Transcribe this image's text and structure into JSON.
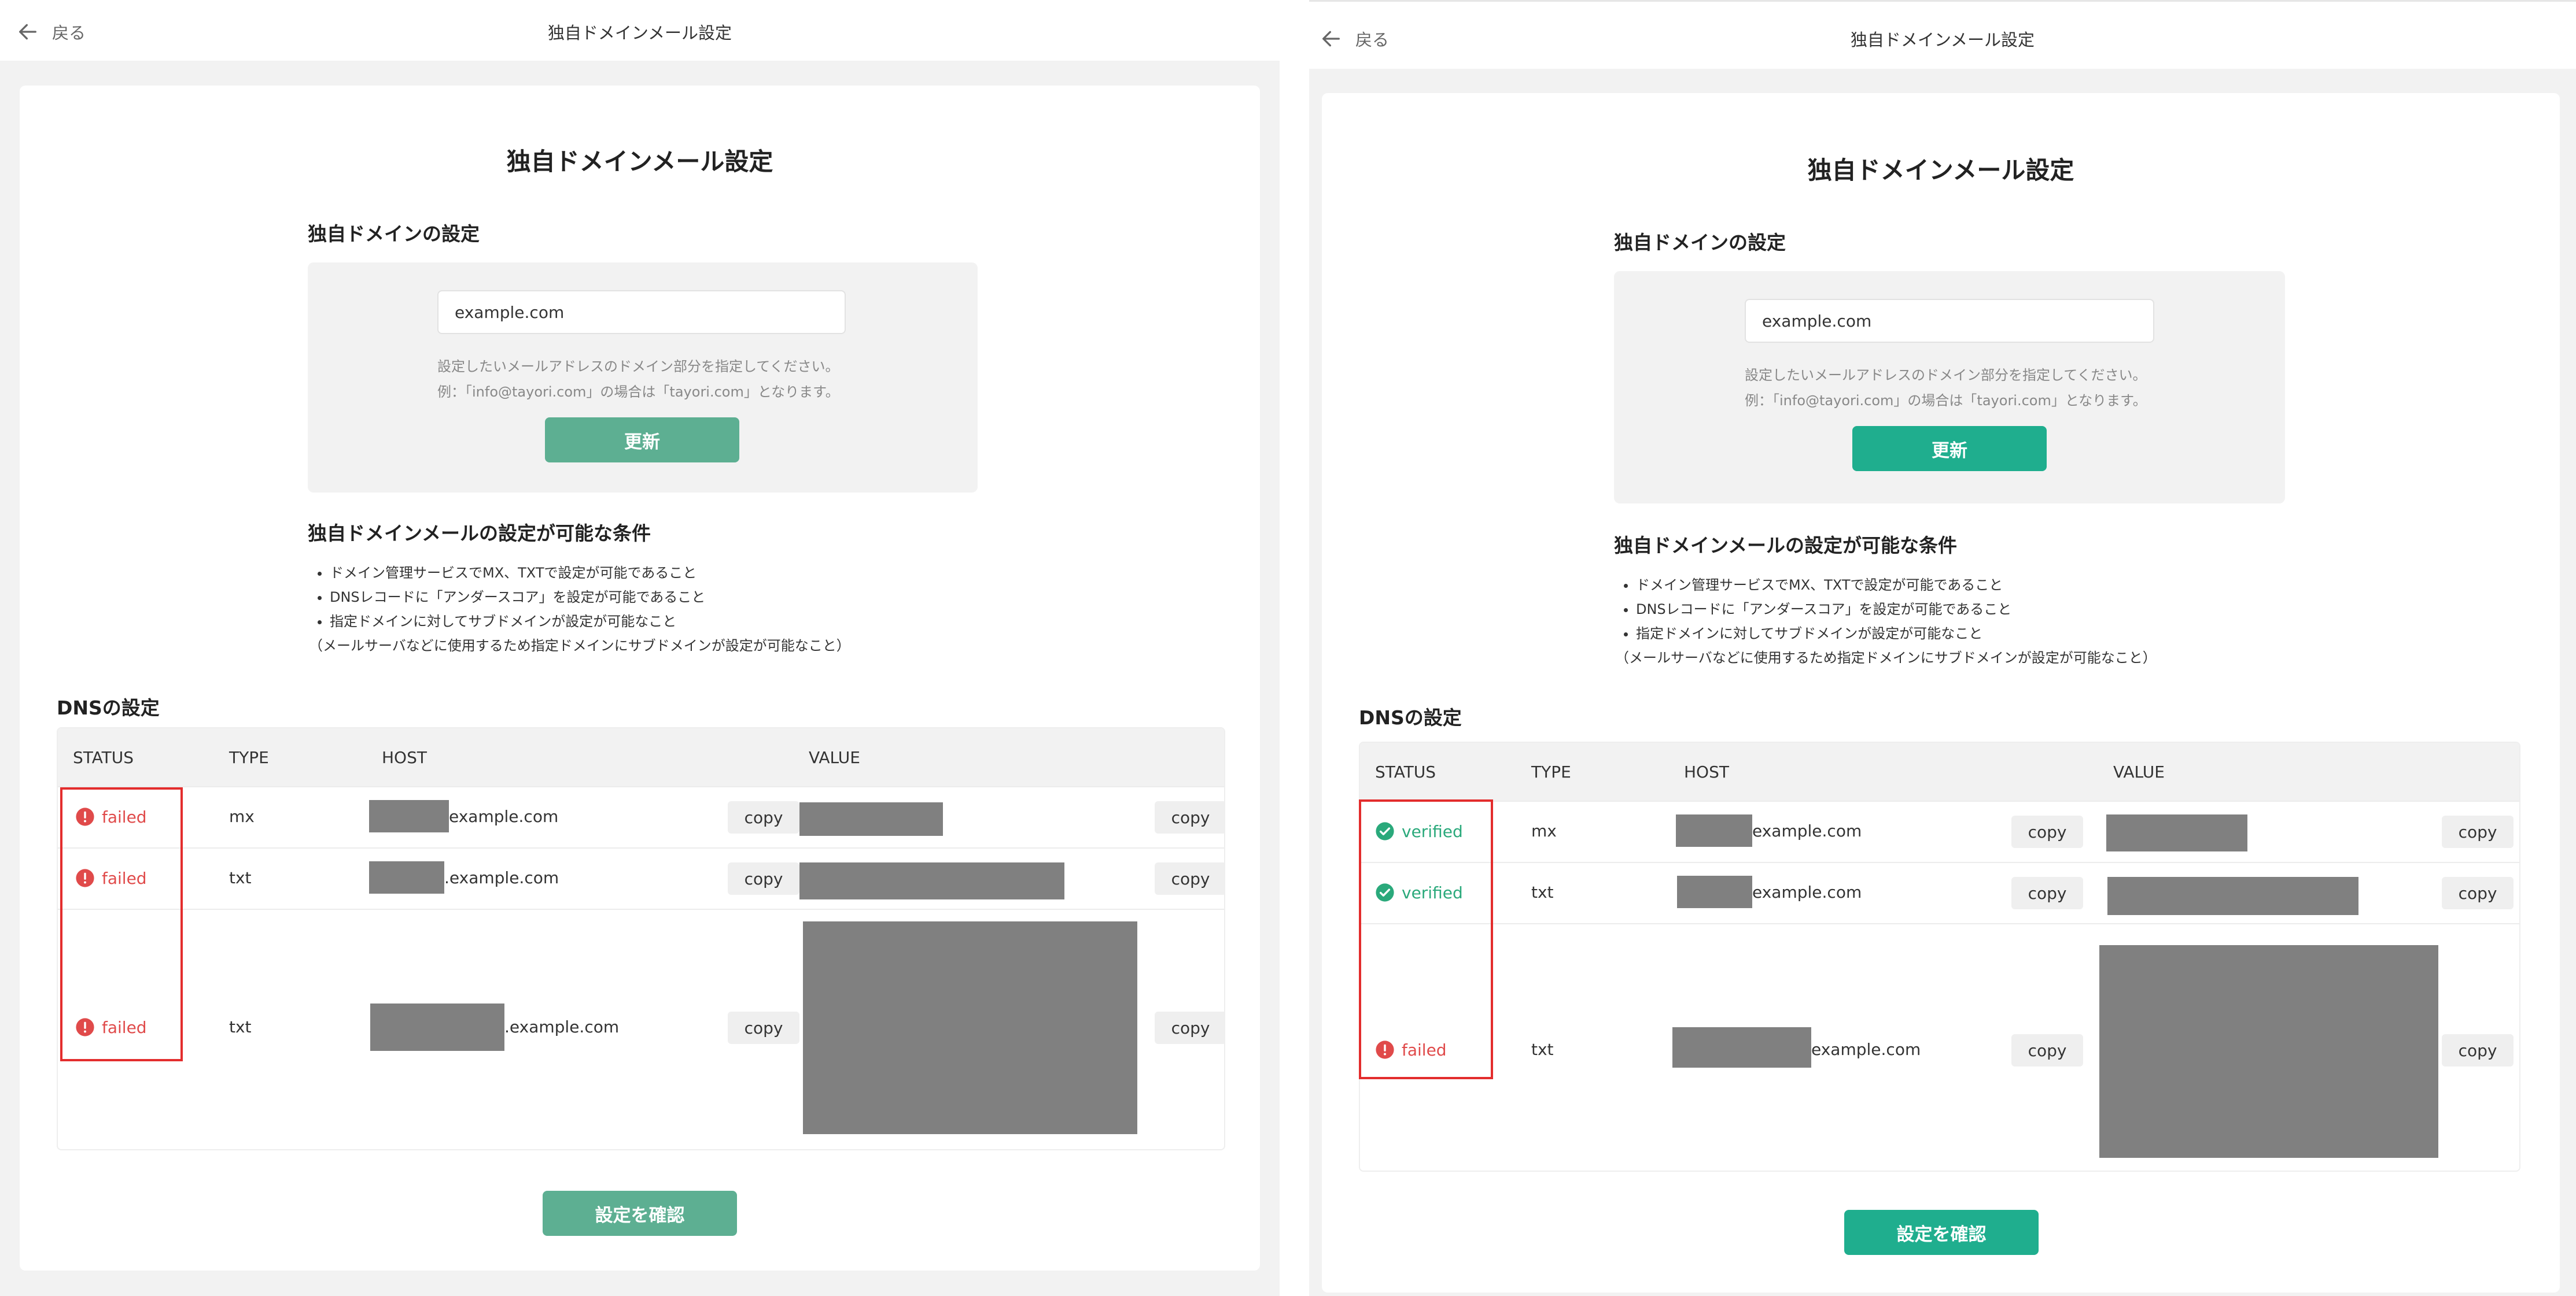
{
  "screens": [
    {
      "back_label": "戻る",
      "window_title": "独自ドメインメール設定",
      "page_title": "独自ドメインメール設定",
      "domain_section_title": "独自ドメインの設定",
      "domain_value": "example.com",
      "hint_line1": "設定したいメールアドレスのドメイン部分を指定してください。",
      "hint_line2": "例：「info@tayori.com」の場合は「tayori.com」となります。",
      "update_label": "更新",
      "conditions_title": "独自ドメインメールの設定が可能な条件",
      "conditions": [
        "ドメイン管理サービスでMX、TXTで設定が可能であること",
        "DNSレコードに「アンダースコア」を設定が可能であること",
        "指定ドメインに対してサブドメインが設定が可能なこと"
      ],
      "conditions_note": "（メールサーバなどに使用するため指定ドメインにサブドメインが設定が可能なこと）",
      "dns_title": "DNSの設定",
      "columns": [
        "STATUS",
        "TYPE",
        "HOST",
        "VALUE"
      ],
      "rows": [
        {
          "status": "failed",
          "type": "mx",
          "host_suffix": "example.com",
          "copy_host": "copy",
          "copy_value": "copy"
        },
        {
          "status": "failed",
          "type": "txt",
          "host_suffix": ".example.com",
          "copy_host": "copy",
          "copy_value": "copy"
        },
        {
          "status": "failed",
          "type": "txt",
          "host_suffix": ".example.com",
          "copy_host": "copy",
          "copy_value": "copy"
        }
      ],
      "confirm_label": "設定を確認"
    },
    {
      "back_label": "戻る",
      "window_title": "独自ドメインメール設定",
      "page_title": "独自ドメインメール設定",
      "domain_section_title": "独自ドメインの設定",
      "domain_value": "example.com",
      "hint_line1": "設定したいメールアドレスのドメイン部分を指定してください。",
      "hint_line2": "例：「info@tayori.com」の場合は「tayori.com」となります。",
      "update_label": "更新",
      "conditions_title": "独自ドメインメールの設定が可能な条件",
      "conditions": [
        "ドメイン管理サービスでMX、TXTで設定が可能であること",
        "DNSレコードに「アンダースコア」を設定が可能であること",
        "指定ドメインに対してサブドメインが設定が可能なこと"
      ],
      "conditions_note": "（メールサーバなどに使用するため指定ドメインにサブドメインが設定が可能なこと）",
      "dns_title": "DNSの設定",
      "columns": [
        "STATUS",
        "TYPE",
        "HOST",
        "VALUE"
      ],
      "rows": [
        {
          "status": "verified",
          "type": "mx",
          "host_suffix": "example.com",
          "copy_host": "copy",
          "copy_value": "copy"
        },
        {
          "status": "verified",
          "type": "txt",
          "host_suffix": "example.com",
          "copy_host": "copy",
          "copy_value": "copy"
        },
        {
          "status": "failed",
          "type": "txt",
          "host_suffix": "example.com",
          "copy_host": "copy",
          "copy_value": "copy"
        }
      ],
      "confirm_label": "設定を確認"
    }
  ],
  "colors": {
    "failed": "#e04a4a",
    "verified": "#2aa97b",
    "highlight_box": "#e32d2d",
    "redaction": "#808080"
  },
  "icons": {
    "back": "arrow-left-icon",
    "failed": "exclamation-circle-icon",
    "verified": "check-circle-icon"
  }
}
